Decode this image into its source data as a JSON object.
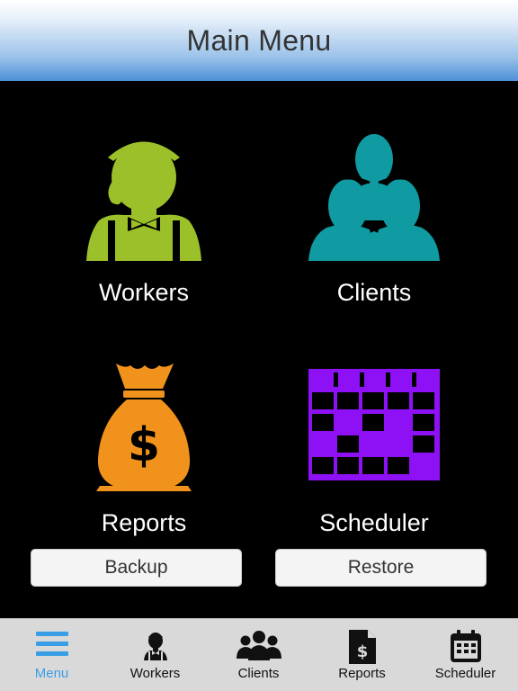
{
  "header": {
    "title": "Main Menu"
  },
  "tiles": [
    {
      "label": "Workers",
      "icon": "worker-icon",
      "color": "#9bc02a"
    },
    {
      "label": "Clients",
      "icon": "clients-icon",
      "color": "#109aa1"
    },
    {
      "label": "Reports",
      "icon": "money-bag-icon",
      "color": "#f0921b"
    },
    {
      "label": "Scheduler",
      "icon": "calendar-grid-icon",
      "color": "#8e11f5"
    }
  ],
  "buttons": {
    "backup": "Backup",
    "restore": "Restore"
  },
  "tabbar": {
    "active_color": "#3a9ee6",
    "tabs": [
      {
        "label": "Menu",
        "icon": "hamburger-icon",
        "active": true
      },
      {
        "label": "Workers",
        "icon": "worker-icon",
        "active": false
      },
      {
        "label": "Clients",
        "icon": "clients-icon",
        "active": false
      },
      {
        "label": "Reports",
        "icon": "report-document-icon",
        "active": false
      },
      {
        "label": "Scheduler",
        "icon": "calendar-icon",
        "active": false
      }
    ]
  }
}
